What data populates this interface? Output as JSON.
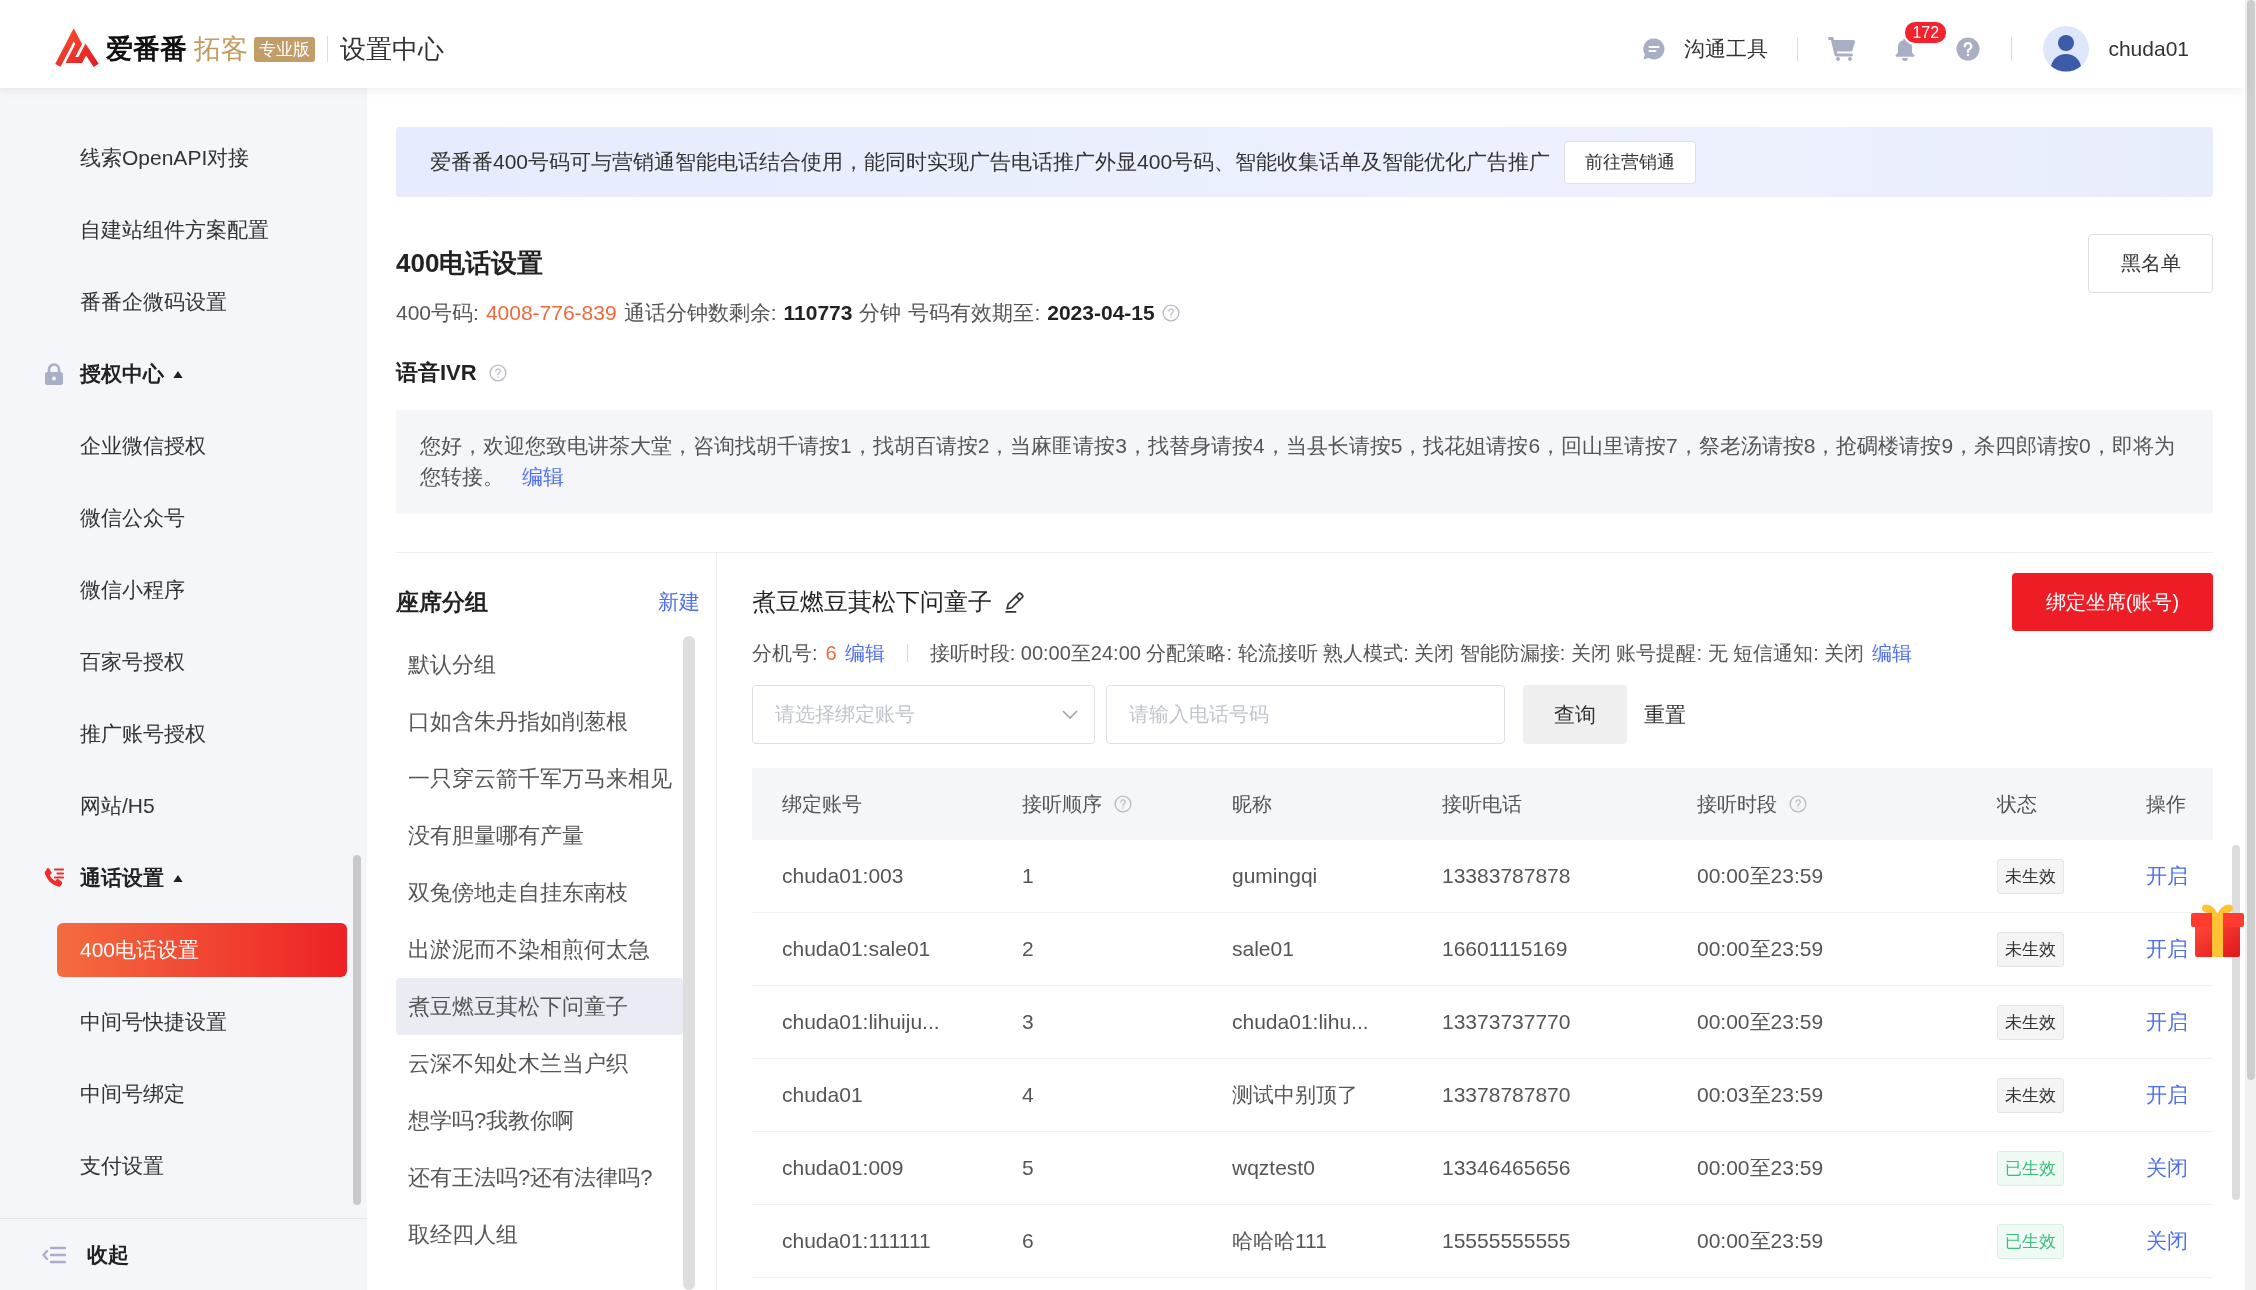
{
  "header": {
    "logo": {
      "brand": "爱番番",
      "product": "拓客",
      "edition": "专业版"
    },
    "title": "设置中心",
    "tools_label": "沟通工具",
    "notifications_badge": "172",
    "user": {
      "name": "chuda01"
    }
  },
  "sidebar": {
    "items": [
      {
        "label": "线索OpenAPI对接",
        "selected": false
      },
      {
        "label": "自建站组件方案配置",
        "selected": false
      },
      {
        "label": "番番企微码设置",
        "selected": false
      }
    ],
    "sections": [
      {
        "label": "授权中心",
        "expanded": true,
        "children": [
          {
            "label": "企业微信授权",
            "selected": false
          },
          {
            "label": "微信公众号",
            "selected": false
          },
          {
            "label": "微信小程序",
            "selected": false
          },
          {
            "label": "百家号授权",
            "selected": false
          },
          {
            "label": "推广账号授权",
            "selected": false
          },
          {
            "label": "网站/H5",
            "selected": false
          }
        ]
      },
      {
        "label": "通话设置",
        "expanded": true,
        "children": [
          {
            "label": "400电话设置",
            "selected": true
          },
          {
            "label": "中间号快捷设置",
            "selected": false
          },
          {
            "label": "中间号绑定",
            "selected": false
          },
          {
            "label": "支付设置",
            "selected": false
          }
        ]
      }
    ],
    "collapse_label": "收起"
  },
  "banner": {
    "text": "爱番番400号码可与营销通智能电话结合使用，能同时实现广告电话推广外显400号码、智能收集话单及智能优化广告推广",
    "button": "前往营销通"
  },
  "phone_settings": {
    "title": "400电话设置",
    "blacklist_button": "黑名单",
    "number_label": "400号码:",
    "number": "4008-776-839",
    "minutes_label": "通话分钟数剩余:",
    "minutes": "110773",
    "minutes_unit": "分钟",
    "expiry_label": "号码有效期至:",
    "expiry": "2023-04-15"
  },
  "ivr": {
    "title": "语音IVR",
    "text": "您好，欢迎您致电讲茶大堂，咨询找胡千请按1，找胡百请按2，当麻匪请按3，找替身请按4，当县长请按5，找花姐请按6，回山里请按7，祭老汤请按8，抢碉楼请按9，杀四郎请按0，即将为您转接。",
    "edit_link": "编辑"
  },
  "seat_groups": {
    "title": "座席分组",
    "new_link": "新建",
    "items": [
      {
        "label": "默认分组",
        "selected": false
      },
      {
        "label": "口如含朱丹指如削葱根",
        "selected": false
      },
      {
        "label": "一只穿云箭千军万马来相见",
        "selected": false
      },
      {
        "label": "没有胆量哪有产量",
        "selected": false
      },
      {
        "label": "双兔傍地走自挂东南枝",
        "selected": false
      },
      {
        "label": "出淤泥而不染相煎何太急",
        "selected": false
      },
      {
        "label": "煮豆燃豆萁松下问童子",
        "selected": true
      },
      {
        "label": "云深不知处木兰当户织",
        "selected": false
      },
      {
        "label": "想学吗?我教你啊",
        "selected": false
      },
      {
        "label": "还有王法吗?还有法律吗?",
        "selected": false
      },
      {
        "label": "取经四人组",
        "selected": false
      }
    ]
  },
  "group_detail": {
    "title": "煮豆燃豆萁松下问童子",
    "bind_button": "绑定坐席(账号)",
    "extension_label": "分机号:",
    "extension": "6",
    "extension_edit": "编辑",
    "settings_summary": "接听时段: 00:00至24:00 分配策略: 轮流接听 熟人模式: 关闭 智能防漏接: 关闭 账号提醒: 无 短信通知: 关闭",
    "settings_edit": "编辑",
    "filters": {
      "account_select": {
        "placeholder": "请选择绑定账号"
      },
      "phone_input": {
        "placeholder": "请输入电话号码"
      },
      "query_button": "查询",
      "reset_button": "重置"
    },
    "table": {
      "columns": [
        {
          "label": "绑定账号",
          "help": false
        },
        {
          "label": "接听顺序",
          "help": true
        },
        {
          "label": "昵称",
          "help": false
        },
        {
          "label": "接听电话",
          "help": false
        },
        {
          "label": "接听时段",
          "help": true
        },
        {
          "label": "状态",
          "help": false
        },
        {
          "label": "操作",
          "help": false
        }
      ],
      "rows": [
        {
          "account": "chuda01:003",
          "order": "1",
          "nickname": "gumingqi",
          "phone": "13383787878",
          "hours": "00:00至23:59",
          "status": {
            "text": "未生效",
            "active": false
          },
          "action": "开启"
        },
        {
          "account": "chuda01:sale01",
          "order": "2",
          "nickname": "sale01",
          "phone": "16601115169",
          "hours": "00:00至23:59",
          "status": {
            "text": "未生效",
            "active": false
          },
          "action": "开启"
        },
        {
          "account": "chuda01:lihuiju...",
          "order": "3",
          "nickname": "chuda01:lihu...",
          "phone": "13373737770",
          "hours": "00:00至23:59",
          "status": {
            "text": "未生效",
            "active": false
          },
          "action": "开启"
        },
        {
          "account": "chuda01",
          "order": "4",
          "nickname": "测试中别顶了",
          "phone": "13378787870",
          "hours": "00:03至23:59",
          "status": {
            "text": "未生效",
            "active": false
          },
          "action": "开启"
        },
        {
          "account": "chuda01:009",
          "order": "5",
          "nickname": "wqztest0",
          "phone": "13346465656",
          "hours": "00:00至23:59",
          "status": {
            "text": "已生效",
            "active": true
          },
          "action": "关闭"
        },
        {
          "account": "chuda01:111111",
          "order": "6",
          "nickname": "哈哈哈111",
          "phone": "15555555555",
          "hours": "00:00至23:59",
          "status": {
            "text": "已生效",
            "active": true
          },
          "action": "关闭"
        }
      ]
    }
  }
}
